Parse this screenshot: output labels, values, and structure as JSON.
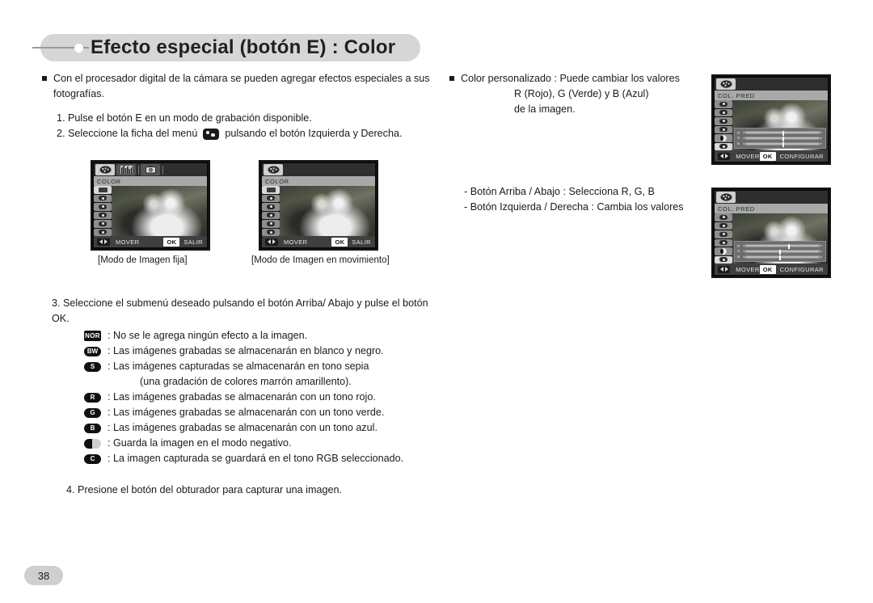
{
  "header": {
    "title": "Efecto especial (botón E) : Color"
  },
  "left": {
    "intro": "Con el procesador digital de la cámara se pueden agregar efectos especiales a sus fotografías.",
    "step1": "1. Pulse el botón E en un modo de grabación disponible.",
    "step2_before": "2. Seleccione la ficha del menú",
    "step2_after": "pulsando el botón Izquierda y Derecha.",
    "step3": "3. Seleccione el submenú deseado pulsando el botón Arriba/ Abajo y pulse el botón OK.",
    "effects": [
      {
        "icon": "NOR",
        "icon_shape": "rect",
        "text": ": No se le agrega ningún efecto a la imagen."
      },
      {
        "icon": "BW",
        "icon_shape": "oval",
        "text": ": Las imágenes grabadas se almacenarán en blanco y negro."
      },
      {
        "icon": "S",
        "icon_shape": "oval",
        "text": ": Las imágenes capturadas se almacenarán en tono sepia"
      },
      {
        "icon": "R",
        "icon_shape": "oval",
        "text": ": Las imágenes grabadas se almacenarán con un tono rojo."
      },
      {
        "icon": "G",
        "icon_shape": "oval",
        "text": ": Las imágenes grabadas se almacenarán con un tono verde."
      },
      {
        "icon": "B",
        "icon_shape": "oval",
        "text": ": Las imágenes grabadas se almacenarán con un tono azul."
      },
      {
        "icon": "",
        "icon_shape": "neg",
        "text": ": Guarda la imagen en el modo negativo."
      },
      {
        "icon": "C",
        "icon_shape": "oval",
        "text": ": La imagen capturada se guardará en el tono RGB seleccionado."
      }
    ],
    "sepia_note": "(una gradación de colores marrón amarillento).",
    "step4": "4. Presione el botón del obturador para capturar una imagen."
  },
  "right": {
    "intro": "Color personalizado : Puede cambiar los valores",
    "intro_line2": "R (Rojo), G (Verde) y  B (Azul)",
    "intro_line3": "de la imagen.",
    "note1": "- Botón Arriba / Abajo : Selecciona R, G, B",
    "note2": "- Botón Izquierda / Derecha : Cambia los valores"
  },
  "screens": {
    "still": {
      "menu_title": "COLOR",
      "mover": "MOVER",
      "ok": "OK",
      "action": "SALIR",
      "caption": "[Modo de Imagen fija]"
    },
    "movie": {
      "menu_title": "COLOR",
      "mover": "MOVER",
      "ok": "OK",
      "action": "SALIR",
      "caption": "[Modo de Imagen en movimiento]"
    },
    "custom_top": {
      "menu_title": "COL. PRED",
      "mover": "MOVER",
      "ok": "OK",
      "action": "CONFIGURAR",
      "rgb": [
        {
          "label": "R",
          "value": 50
        },
        {
          "label": "G",
          "value": 50
        },
        {
          "label": "B",
          "value": 50
        }
      ]
    },
    "custom_bottom": {
      "menu_title": "COL. PRED",
      "mover": "MOVER",
      "ok": "OK",
      "action": "CONFIGURAR",
      "rgb": [
        {
          "label": "R",
          "value": 58
        },
        {
          "label": "G",
          "value": 45
        },
        {
          "label": "B",
          "value": 45
        }
      ]
    }
  },
  "footer": {
    "page_number": "38"
  },
  "colors": {
    "title_bar_bg": "#d6d6d6",
    "page_bg": "#ffffff",
    "text": "#1a1a1a"
  }
}
